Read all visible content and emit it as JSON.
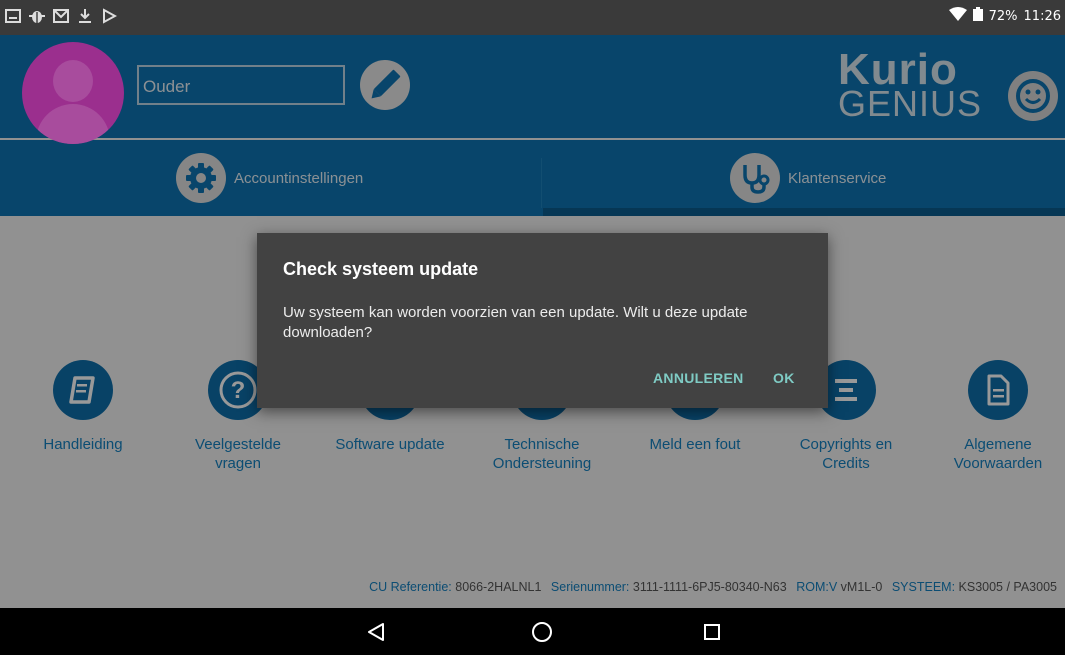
{
  "status_bar": {
    "left_icons": [
      "image-icon",
      "bug-icon",
      "gmail-icon",
      "download-icon",
      "play-store-icon"
    ],
    "battery": "72%",
    "time": "11:26"
  },
  "header": {
    "profile_name": "Ouder",
    "logo": {
      "line1": "Kurio",
      "line2": "GENIUS"
    }
  },
  "tabs": [
    {
      "label": "Accountinstellingen",
      "icon": "gear-icon"
    },
    {
      "label": "Klantenservice",
      "icon": "stethoscope-icon",
      "selected": true
    }
  ],
  "grid": [
    {
      "label": "Handleiding",
      "icon": "manual-icon"
    },
    {
      "label": "Veelgestelde vragen",
      "icon": "question-icon"
    },
    {
      "label": "Software update",
      "icon": "update-icon"
    },
    {
      "label": "Technische Ondersteuning",
      "icon": "support-icon"
    },
    {
      "label": "Meld een fout",
      "icon": "report-icon"
    },
    {
      "label": "Copyrights en Credits",
      "icon": "credits-icon"
    },
    {
      "label": "Algemene Voorwaarden",
      "icon": "document-icon"
    }
  ],
  "footer": {
    "cu_label": "CU Referentie:",
    "cu_value": "8066-2HALNL1",
    "serial_label": "Serienummer:",
    "serial_value": "3111-1111-6PJ5-80340-N63",
    "rom_label": "ROM:V",
    "rom_value": "vM1L-0",
    "system_label": "SYSTEEM:",
    "system_value": "KS3005 / PA3005"
  },
  "dialog": {
    "title": "Check systeem update",
    "message": "Uw systeem kan worden voorzien van een update. Wilt u deze update downloaden?",
    "cancel": "ANNULEREN",
    "ok": "OK"
  },
  "colors": {
    "header_blue": "#0e74b2",
    "link_blue": "#1580c0",
    "avatar_purple": "#9b2f8e",
    "dialog_bg": "#424242",
    "dialog_button": "#7fcbc4"
  }
}
